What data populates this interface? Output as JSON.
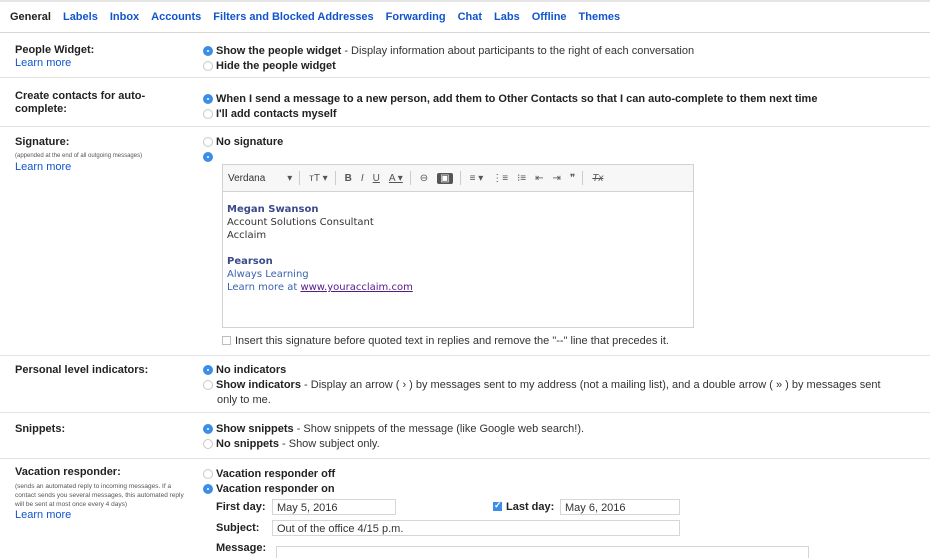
{
  "tabs": [
    "General",
    "Labels",
    "Inbox",
    "Accounts",
    "Filters and Blocked Addresses",
    "Forwarding",
    "Chat",
    "Labs",
    "Offline",
    "Themes"
  ],
  "people_widget": {
    "label": "People Widget:",
    "learn_more": "Learn more",
    "opt_show": "Show the people widget",
    "opt_show_desc": " - Display information about participants to the right of each conversation",
    "opt_hide": "Hide the people widget"
  },
  "create_contacts": {
    "label": "Create contacts for auto-complete:",
    "opt_auto": "When I send a message to a new person, add them to Other Contacts so that I can auto-complete to them next time",
    "opt_manual": "I'll add contacts myself"
  },
  "signature": {
    "label": "Signature:",
    "sub": "(appended at the end of all outgoing messages)",
    "learn_more": "Learn more",
    "opt_none": "No signature",
    "toolbar": {
      "font": "Verdana",
      "font_caret": "▾",
      "size": "тT ▾",
      "bold": "B",
      "italic": "I",
      "underline": "U",
      "text_color": "A ▾",
      "link": "⊖",
      "image": "▣",
      "align": "≡ ▾",
      "numbered": "⋮≡",
      "bulleted": "⁝≡",
      "indent_less": "⇤",
      "indent_more": "⇥",
      "quote": "❞",
      "clear": "Tx"
    },
    "name": "Megan Swanson",
    "title": "Account Solutions Consultant",
    "company": "Acclaim",
    "org": "Pearson",
    "tagline": "Always Learning",
    "learn_prefix": "Learn more at ",
    "link": "www.youracclaim.com",
    "insert_before": "Insert this signature before quoted text in replies and remove the \"--\" line that precedes it."
  },
  "personal_level": {
    "label": "Personal level indicators:",
    "opt_none": "No indicators",
    "opt_show": "Show indicators",
    "opt_show_desc": " - Display an arrow ( › ) by messages sent to my address (not a mailing list), and a double arrow ( » ) by messages sent",
    "opt_show_desc2": "only to me."
  },
  "snippets": {
    "label": "Snippets:",
    "opt_show": "Show snippets",
    "opt_show_desc": " - Show snippets of the message (like Google web search!).",
    "opt_none": "No snippets",
    "opt_none_desc": " - Show subject only."
  },
  "vacation": {
    "label": "Vacation responder:",
    "sub": "(sends an automated reply to incoming messages. If a contact sends you several messages, this automated reply will be sent at most once every 4 days)",
    "learn_more": "Learn more",
    "opt_off": "Vacation responder off",
    "opt_on": "Vacation responder on",
    "first_day_label": "First day:",
    "first_day": "May 5, 2016",
    "last_day_label": "Last day:",
    "last_day": "May 6, 2016",
    "subject_label": "Subject:",
    "subject": "Out of the office 4/15 p.m.",
    "message_label": "Message:"
  }
}
